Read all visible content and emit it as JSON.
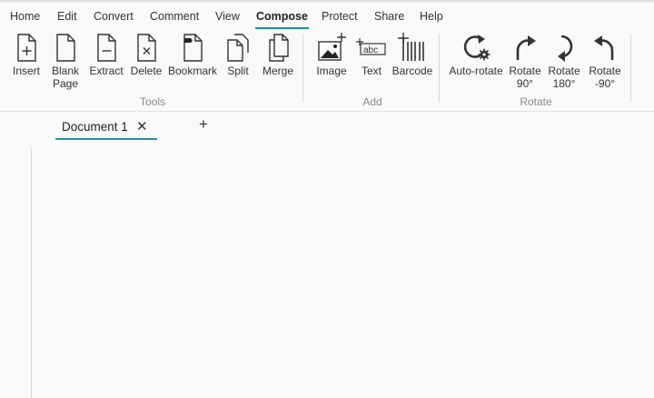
{
  "menu": {
    "items": [
      "Home",
      "Edit",
      "Convert",
      "Comment",
      "View",
      "Compose",
      "Protect",
      "Share",
      "Help"
    ],
    "active": "Compose"
  },
  "ribbon": {
    "groups": {
      "tools": "Tools",
      "add": "Add",
      "rotate": "Rotate"
    },
    "tools": {
      "insert": "Insert",
      "blank_page_1": "Blank",
      "blank_page_2": "Page",
      "extract": "Extract",
      "delete": "Delete",
      "bookmark": "Bookmark",
      "split": "Split",
      "merge": "Merge"
    },
    "add": {
      "image": "Image",
      "text": "Text",
      "barcode": "Barcode",
      "text_icon_glyph": "abc"
    },
    "rotate": {
      "auto": "Auto-rotate",
      "r90_1": "Rotate",
      "r90_2": "90°",
      "r180_1": "Rotate",
      "r180_2": "180°",
      "rneg90_1": "Rotate",
      "rneg90_2": "-90°"
    }
  },
  "tabs": {
    "document": "Document 1",
    "close_glyph": "✕",
    "add_glyph": "+"
  },
  "colors": {
    "accent": "#1f8fa8",
    "background": "#f9f9f9"
  }
}
